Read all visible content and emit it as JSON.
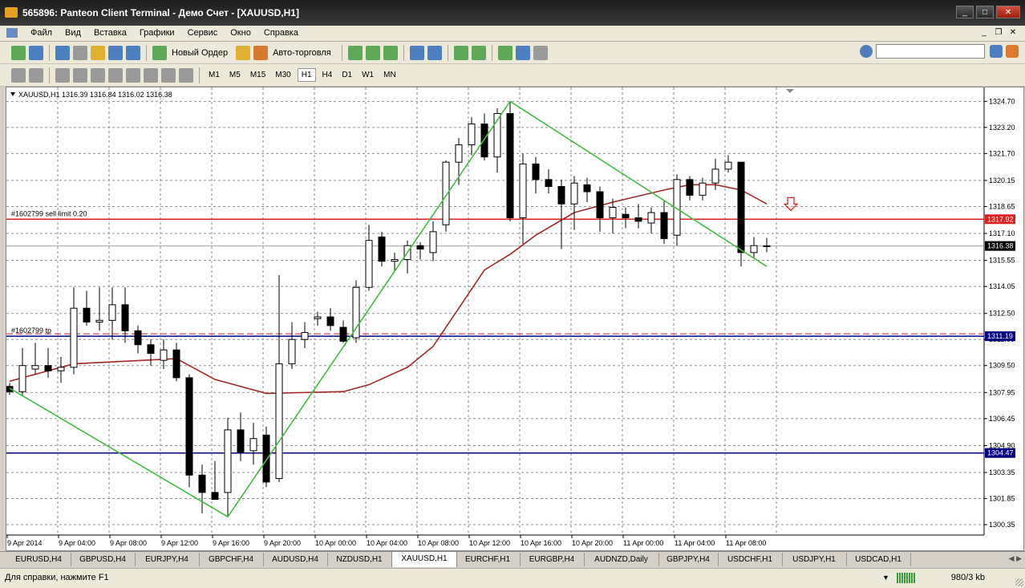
{
  "window": {
    "title": "565896: Panteon Client Terminal - Демо Счет - [XAUUSD,H1]"
  },
  "menu": {
    "items": [
      "Файл",
      "Вид",
      "Вставка",
      "Графики",
      "Сервис",
      "Окно",
      "Справка"
    ]
  },
  "toolbar": {
    "new_order_label": "Новый Ордер",
    "autotrading_label": "Авто-торговля"
  },
  "timeframes": [
    "M1",
    "M5",
    "M15",
    "M30",
    "H1",
    "H4",
    "D1",
    "W1",
    "MN"
  ],
  "active_timeframe": "H1",
  "colors": {
    "bull": "#ffffff",
    "bear": "#000000",
    "ma": "#a02828",
    "zigzag": "#44bb44",
    "red_line": "#dd2020",
    "navy_line": "#000080",
    "grid": "#909090"
  },
  "chart_data": {
    "type": "candlestick",
    "symbol_header": "XAUUSD,H1  1316.39 1316.84 1316.02 1316.38",
    "ylim": [
      1299.75,
      1325.5
    ],
    "y_ticks": [
      "1324.70",
      "1323.20",
      "1321.70",
      "1320.15",
      "1318.65",
      "1317.10",
      "1315.55",
      "1314.05",
      "1312.50",
      "1311.00",
      "1309.50",
      "1307.95",
      "1306.45",
      "1304.90",
      "1303.35",
      "1301.85",
      "1300.35"
    ],
    "x_ticks": [
      "9 Apr 2014",
      "9 Apr 04:00",
      "9 Apr 08:00",
      "9 Apr 12:00",
      "9 Apr 16:00",
      "9 Apr 20:00",
      "10 Apr 00:00",
      "10 Apr 04:00",
      "10 Apr 08:00",
      "10 Apr 12:00",
      "10 Apr 16:00",
      "10 Apr 20:00",
      "11 Apr 00:00",
      "11 Apr 04:00",
      "11 Apr 08:00"
    ],
    "candles": [
      [
        1308.3,
        1308.5,
        1307.8,
        1308.0
      ],
      [
        1308.0,
        1310.5,
        1307.8,
        1309.5
      ],
      [
        1309.3,
        1310.8,
        1309.0,
        1309.5
      ],
      [
        1309.5,
        1310.5,
        1308.8,
        1309.2
      ],
      [
        1309.2,
        1310.0,
        1308.5,
        1309.4
      ],
      [
        1309.4,
        1314.0,
        1309.0,
        1312.8
      ],
      [
        1312.8,
        1313.8,
        1311.8,
        1312.0
      ],
      [
        1312.0,
        1314.0,
        1311.5,
        1312.1
      ],
      [
        1312.1,
        1314.0,
        1311.0,
        1313.0
      ],
      [
        1313.0,
        1314.0,
        1310.8,
        1311.5
      ],
      [
        1311.5,
        1311.8,
        1310.2,
        1310.7
      ],
      [
        1310.7,
        1311.0,
        1309.5,
        1310.2
      ],
      [
        1309.8,
        1311.0,
        1309.3,
        1310.4
      ],
      [
        1310.4,
        1310.8,
        1308.6,
        1308.8
      ],
      [
        1308.8,
        1309.0,
        1302.5,
        1303.2
      ],
      [
        1303.2,
        1303.8,
        1301.0,
        1302.2
      ],
      [
        1302.2,
        1304.0,
        1301.8,
        1301.8
      ],
      [
        1302.2,
        1306.5,
        1300.8,
        1305.8
      ],
      [
        1305.8,
        1306.8,
        1304.0,
        1304.5
      ],
      [
        1304.6,
        1306.2,
        1303.8,
        1305.3
      ],
      [
        1305.5,
        1306.0,
        1302.5,
        1302.8
      ],
      [
        1303.0,
        1314.7,
        1302.8,
        1309.6
      ],
      [
        1309.6,
        1312.0,
        1309.3,
        1311.0
      ],
      [
        1311.0,
        1312.0,
        1310.5,
        1311.4
      ],
      [
        1312.2,
        1312.6,
        1311.8,
        1312.3
      ],
      [
        1312.3,
        1312.8,
        1311.5,
        1311.8
      ],
      [
        1311.7,
        1312.1,
        1310.8,
        1310.9
      ],
      [
        1311.1,
        1314.4,
        1310.8,
        1314.0
      ],
      [
        1314.0,
        1317.6,
        1313.8,
        1316.7
      ],
      [
        1316.9,
        1317.2,
        1315.2,
        1315.5
      ],
      [
        1315.5,
        1316.0,
        1314.9,
        1315.6
      ],
      [
        1315.6,
        1316.7,
        1314.8,
        1316.4
      ],
      [
        1316.4,
        1316.6,
        1315.6,
        1316.2
      ],
      [
        1316.0,
        1317.8,
        1315.5,
        1317.2
      ],
      [
        1317.6,
        1321.3,
        1317.2,
        1321.2
      ],
      [
        1321.2,
        1322.6,
        1319.9,
        1322.2
      ],
      [
        1322.2,
        1323.8,
        1321.6,
        1323.4
      ],
      [
        1323.4,
        1324.0,
        1321.3,
        1321.5
      ],
      [
        1321.5,
        1324.3,
        1320.6,
        1324.0
      ],
      [
        1324.0,
        1324.7,
        1317.8,
        1318.0
      ],
      [
        1318.0,
        1321.7,
        1316.5,
        1321.1
      ],
      [
        1321.1,
        1321.5,
        1319.4,
        1320.2
      ],
      [
        1320.2,
        1320.8,
        1319.4,
        1319.8
      ],
      [
        1319.8,
        1320.2,
        1316.2,
        1318.8
      ],
      [
        1318.8,
        1320.4,
        1317.3,
        1320.0
      ],
      [
        1319.9,
        1320.3,
        1318.9,
        1319.5
      ],
      [
        1319.5,
        1319.8,
        1317.2,
        1318.0
      ],
      [
        1318.0,
        1319.1,
        1317.1,
        1318.6
      ],
      [
        1318.2,
        1318.6,
        1317.4,
        1318.0
      ],
      [
        1318.0,
        1318.8,
        1317.4,
        1317.8
      ],
      [
        1317.7,
        1318.6,
        1317.1,
        1318.3
      ],
      [
        1318.3,
        1319.0,
        1316.5,
        1316.8
      ],
      [
        1317.0,
        1320.5,
        1316.4,
        1320.2
      ],
      [
        1320.2,
        1320.4,
        1319.0,
        1319.3
      ],
      [
        1319.3,
        1320.3,
        1319.0,
        1320.0
      ],
      [
        1320.0,
        1321.4,
        1319.6,
        1320.8
      ],
      [
        1320.8,
        1321.6,
        1320.6,
        1321.2
      ],
      [
        1321.2,
        1321.2,
        1315.2,
        1316.0
      ],
      [
        1316.0,
        1316.9,
        1315.7,
        1316.4
      ],
      [
        1316.39,
        1316.84,
        1316.02,
        1316.38
      ]
    ],
    "moving_average": [
      [
        0,
        1308.6
      ],
      [
        5,
        1309.6
      ],
      [
        13,
        1309.9
      ],
      [
        16,
        1308.7
      ],
      [
        20,
        1307.9
      ],
      [
        26,
        1308.0
      ],
      [
        28,
        1308.4
      ],
      [
        31,
        1309.4
      ],
      [
        33,
        1310.6
      ],
      [
        35,
        1312.8
      ],
      [
        37,
        1315.0
      ],
      [
        39,
        1315.9
      ],
      [
        41,
        1317.0
      ],
      [
        44,
        1318.3
      ],
      [
        47,
        1318.9
      ],
      [
        51,
        1319.6
      ],
      [
        53,
        1319.9
      ],
      [
        55,
        1319.9
      ],
      [
        57,
        1319.6
      ],
      [
        59,
        1318.8
      ]
    ],
    "zigzag": [
      [
        0,
        1308.2
      ],
      [
        17,
        1300.8
      ],
      [
        39,
        1324.7
      ],
      [
        59,
        1315.2
      ]
    ],
    "levels": [
      {
        "price": 1317.92,
        "label": "#1602799 sell limit 0.20",
        "price_label": "1317.92",
        "color": "#dd2020"
      },
      {
        "price": 1311.19,
        "label": "#1602799 tp",
        "price_label": "1311.19",
        "color": "#000080"
      },
      {
        "price": 1304.47,
        "label": "",
        "price_label": "1304.47",
        "color": "#000080"
      }
    ],
    "bid_line": {
      "price": 1316.38,
      "price_label": "1316.38"
    }
  },
  "tabs": [
    "EURUSD,H4",
    "GBPUSD,H4",
    "EURJPY,H4",
    "GBPCHF,H4",
    "AUDUSD,H4",
    "NZDUSD,H1",
    "XAUUSD,H1",
    "EURCHF,H1",
    "EURGBP,H4",
    "AUDNZD,Daily",
    "GBPJPY,H4",
    "USDCHF,H1",
    "USDJPY,H1",
    "USDCAD,H1"
  ],
  "active_tab": "XAUUSD,H1",
  "status": {
    "help_text": "Для справки, нажмите F1",
    "traffic": "980/3 kb"
  }
}
